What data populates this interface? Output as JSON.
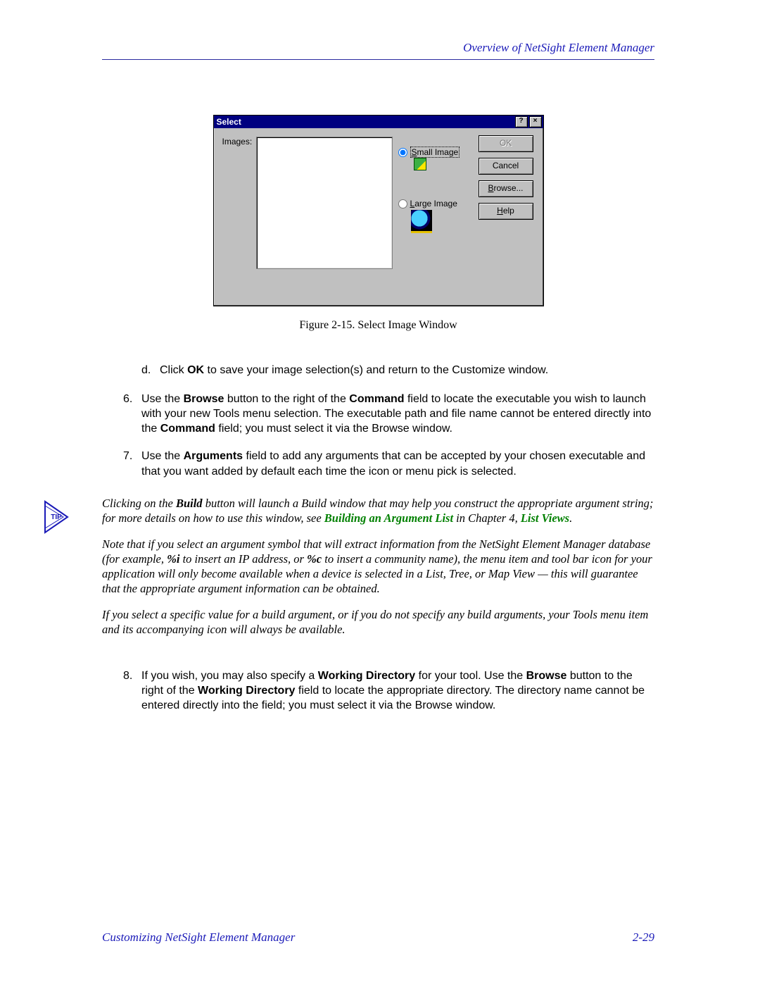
{
  "header": {
    "section_title": "Overview of NetSight Element Manager"
  },
  "dialog": {
    "title": "Select",
    "help_btn_glyph": "?",
    "close_btn_glyph": "×",
    "images_label": "Images:",
    "radio_small_prefix": "S",
    "radio_small_rest": "mall Image",
    "radio_large_prefix": "L",
    "radio_large_rest": "arge Image",
    "buttons": {
      "ok": "OK",
      "cancel": "Cancel",
      "browse_prefix": "B",
      "browse_rest": "rowse...",
      "help_prefix": "H",
      "help_rest": "elp"
    }
  },
  "caption": "Figure 2-15.  Select Image Window",
  "steps": {
    "d": {
      "marker": "d.",
      "pre": "Click ",
      "b1": "OK",
      "post": " to save your image selection(s) and return to the Customize window."
    },
    "s6": {
      "marker": "6.",
      "t1": "Use the ",
      "b1": "Browse",
      "t2": " button to the right of the ",
      "b2": "Command",
      "t3": " field to locate the executable you wish to launch with your new Tools menu selection. The executable path and file name cannot be entered directly into the ",
      "b3": "Command",
      "t4": " field; you must select it via the Browse window."
    },
    "s7": {
      "marker": "7.",
      "t1": "Use the ",
      "b1": "Arguments",
      "t2": " field to add any arguments that can be accepted by your chosen executable and that you want added by default each time the icon or menu pick is selected."
    },
    "s8": {
      "marker": "8.",
      "t1": "If you wish, you may also specify a ",
      "b1": "Working Directory",
      "t2": " for your tool. Use the ",
      "b2": "Browse",
      "t3": " button to the right of the ",
      "b3": "Working Directory",
      "t4": " field to locate the appropriate directory. The directory name cannot be entered directly into the field; you must select it via the Browse window."
    }
  },
  "tip": {
    "label": "TIP",
    "p1": {
      "t1": "Clicking on the ",
      "b1": "Build",
      "t2": " button will launch a Build window that may help you construct the appropriate argument string; for more details on how to use this window, see ",
      "link1": "Building an Argument List",
      "t3": " in Chapter 4, ",
      "link2": "List Views",
      "t4": "."
    },
    "p2": {
      "t1": "Note that if you select an argument symbol that will extract information from the NetSight Element Manager database (for example, ",
      "b1": "%i",
      "t2": " to insert an IP address, or ",
      "b2": "%c",
      "t3": " to insert a community name), the menu item and tool bar icon for your application will only become available when a device is selected in a List, Tree, or Map View — this will guarantee that the appropriate argument information can be obtained."
    },
    "p3": "If you select a specific value for a build argument, or if you do not specify any build arguments, your Tools menu item and its accompanying icon will always be available."
  },
  "footer": {
    "left": "Customizing NetSight Element Manager",
    "right": "2-29"
  }
}
